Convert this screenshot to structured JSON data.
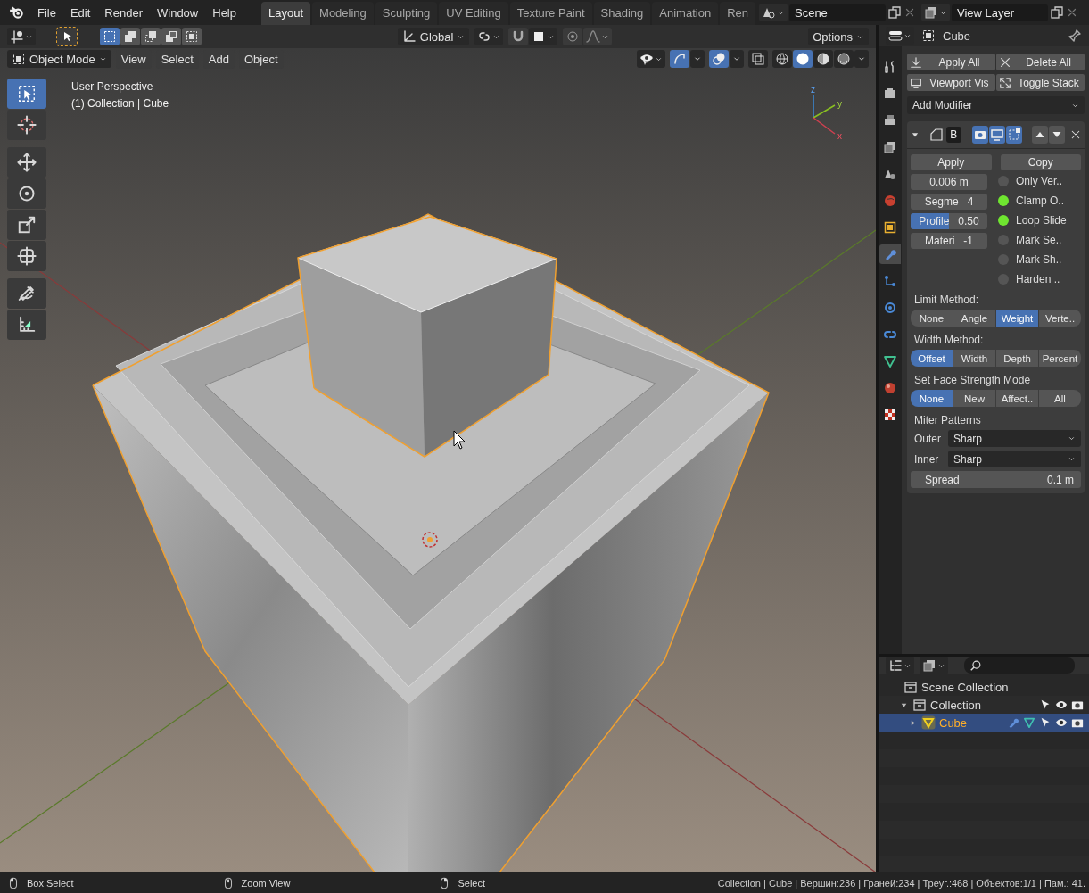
{
  "topbar": {
    "menus": [
      "File",
      "Edit",
      "Render",
      "Window",
      "Help"
    ],
    "workspaces": [
      {
        "label": "Layout",
        "selected": true
      },
      {
        "label": "Modeling",
        "selected": false
      },
      {
        "label": "Sculpting",
        "selected": false
      },
      {
        "label": "UV Editing",
        "selected": false
      },
      {
        "label": "Texture Paint",
        "selected": false
      },
      {
        "label": "Shading",
        "selected": false
      },
      {
        "label": "Animation",
        "selected": false
      },
      {
        "label": "Ren",
        "selected": false
      }
    ],
    "scene": "Scene",
    "view_layer": "View Layer"
  },
  "tool_header": {
    "select_modes": [
      {
        "kind": "new",
        "selected": true
      },
      {
        "kind": "extend",
        "selected": false
      },
      {
        "kind": "subtract",
        "selected": false
      },
      {
        "kind": "invert",
        "selected": false
      },
      {
        "kind": "intersect",
        "selected": false
      }
    ],
    "orientation": "Global",
    "options": "Options"
  },
  "viewport_header": {
    "mode": "Object Mode",
    "menus": [
      "View",
      "Select",
      "Add",
      "Object"
    ],
    "gizmos_on": true,
    "overlays_on": true,
    "shading": [
      {
        "kind": "wireframe",
        "selected": false
      },
      {
        "kind": "solid",
        "selected": true
      },
      {
        "kind": "material",
        "selected": false
      },
      {
        "kind": "rendered",
        "selected": false
      }
    ]
  },
  "viewport": {
    "info": [
      "User Perspective",
      "(1) Collection | Cube"
    ],
    "axes": [
      "z",
      "y",
      "x"
    ]
  },
  "toolbar": [
    {
      "kind": "select",
      "selected": true
    },
    {
      "kind": "cursor",
      "selected": false
    },
    {
      "kind": "move",
      "selected": false
    },
    {
      "kind": "rotate",
      "selected": false
    },
    {
      "kind": "scale",
      "selected": false
    },
    {
      "kind": "transform",
      "selected": false
    },
    {
      "kind": "annotate",
      "selected": false
    },
    {
      "kind": "measure",
      "selected": false
    }
  ],
  "properties": {
    "object": "Cube",
    "tabs": [
      {
        "kind": "tool",
        "selected": false
      },
      {
        "kind": "render",
        "selected": false
      },
      {
        "kind": "output",
        "selected": false
      },
      {
        "kind": "view_layer",
        "selected": false
      },
      {
        "kind": "scene",
        "selected": false
      },
      {
        "kind": "world",
        "selected": false
      },
      {
        "kind": "object",
        "selected": false
      },
      {
        "kind": "modifiers",
        "selected": true
      },
      {
        "kind": "particles",
        "selected": false
      },
      {
        "kind": "physics",
        "selected": false
      },
      {
        "kind": "constraints",
        "selected": false
      },
      {
        "kind": "data",
        "selected": false
      },
      {
        "kind": "material",
        "selected": false
      },
      {
        "kind": "texture",
        "selected": false
      }
    ],
    "actions": [
      {
        "kind": "apply",
        "label": "Apply All"
      },
      {
        "kind": "delete",
        "label": "Delete All"
      },
      {
        "kind": "viewport",
        "label": "Viewport Vis"
      },
      {
        "kind": "toggle",
        "label": "Toggle Stack"
      }
    ],
    "add_modifier": "Add Modifier",
    "modifier": {
      "expanded": true,
      "name": "B",
      "display": [
        {
          "kind": "render",
          "on": true
        },
        {
          "kind": "viewport",
          "on": true
        },
        {
          "kind": "editmode",
          "on": true
        }
      ],
      "apply": "Apply",
      "copy": "Copy",
      "fields": [
        {
          "value": "0.006 m"
        },
        {
          "label": "Segme",
          "value": "4"
        },
        {
          "label": "Profile",
          "value": "0.50",
          "level": 0.5
        },
        {
          "label": "Materi",
          "value": "-1"
        }
      ],
      "toggles": [
        {
          "label": "Only Ver..",
          "checked": false
        },
        {
          "label": "Clamp O..",
          "checked": true
        },
        {
          "label": "Loop Slide",
          "checked": true
        },
        {
          "label": "Mark Se..",
          "checked": false
        },
        {
          "label": "Mark Sh..",
          "checked": false
        },
        {
          "label": "Harden ..",
          "checked": false
        }
      ],
      "choices": [
        {
          "label": "Limit Method:",
          "options": [
            {
              "label": "None",
              "selected": false
            },
            {
              "label": "Angle",
              "selected": false
            },
            {
              "label": "Weight",
              "selected": true
            },
            {
              "label": "Verte..",
              "selected": false
            }
          ]
        },
        {
          "label": "Width Method:",
          "options": [
            {
              "label": "Offset",
              "selected": true
            },
            {
              "label": "Width",
              "selected": false
            },
            {
              "label": "Depth",
              "selected": false
            },
            {
              "label": "Percent",
              "selected": false
            }
          ]
        },
        {
          "label": "Set Face Strength Mode",
          "options": [
            {
              "label": "None",
              "selected": true
            },
            {
              "label": "New",
              "selected": false
            },
            {
              "label": "Affect..",
              "selected": false
            },
            {
              "label": "All",
              "selected": false
            }
          ]
        }
      ],
      "miter_label": "Miter Patterns",
      "miters": [
        {
          "label": "Outer",
          "value": "Sharp"
        },
        {
          "label": "Inner",
          "value": "Sharp"
        }
      ],
      "spread": {
        "label": "Spread",
        "value": "0.1 m"
      }
    }
  },
  "outliner": {
    "tree": [
      {
        "label": "Scene Collection",
        "kind": "scene",
        "selected": false,
        "children": [
          {
            "label": "Collection",
            "kind": "collection",
            "selected": false,
            "expanded": true,
            "children": [
              {
                "label": "Cube",
                "kind": "mesh",
                "selected": true,
                "expanded": false
              }
            ]
          }
        ]
      }
    ]
  },
  "status_bar": {
    "hints": [
      {
        "kind": "left",
        "label": "Box Select"
      },
      {
        "kind": "middle",
        "label": "Zoom View"
      },
      {
        "kind": "right",
        "label": "Select"
      }
    ],
    "stats": "Collection | Cube | Вершин:236 | Граней:234 | Треуг.:468 | Объектов:1/1 | Пам.: 41."
  }
}
